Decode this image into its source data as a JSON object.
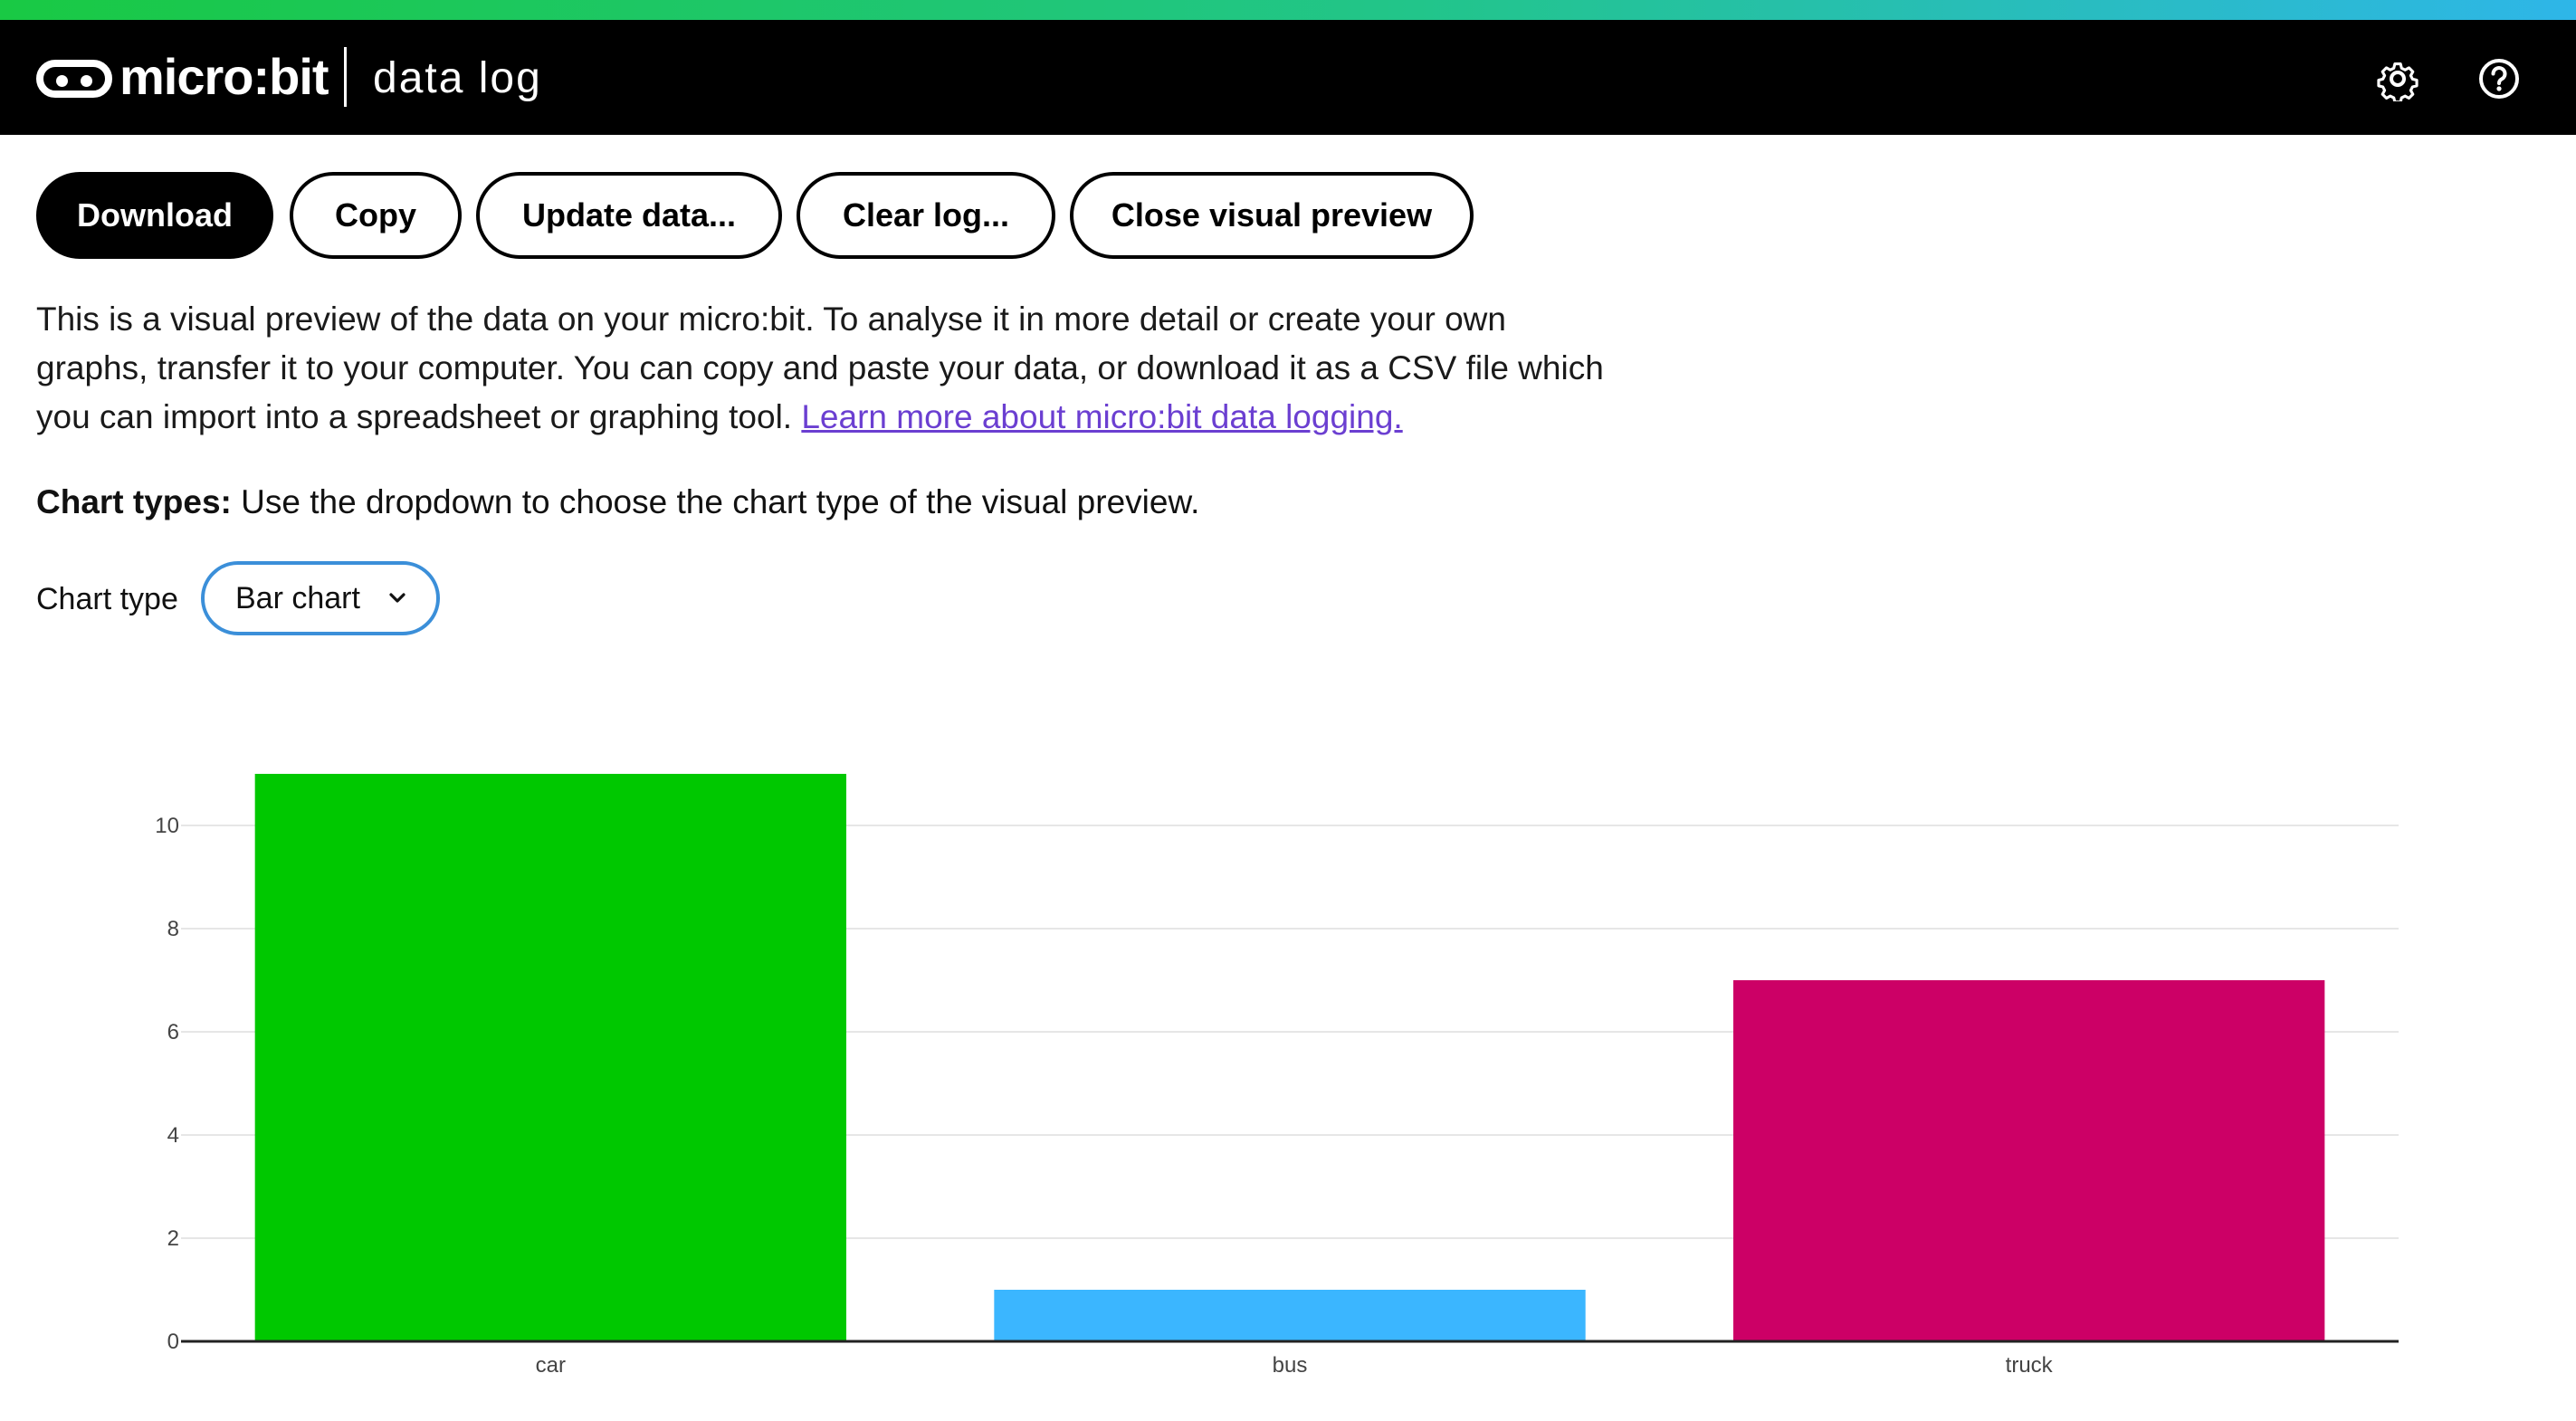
{
  "header": {
    "brand": "micro:bit",
    "app_title": "data log",
    "settings_icon": "gear-icon",
    "help_icon": "help-icon"
  },
  "toolbar": {
    "download": "Download",
    "copy": "Copy",
    "update": "Update data...",
    "clear": "Clear log...",
    "close_preview": "Close visual preview"
  },
  "intro": {
    "text": "This is a visual preview of the data on your micro:bit. To analyse it in more detail or create your own graphs, transfer it to your computer. You can copy and paste your data, or download it as a CSV file which you can import into a spreadsheet or graphing tool.",
    "link": "Learn more about micro:bit data logging."
  },
  "chart_types": {
    "label": "Chart types:",
    "text": "Use the dropdown to choose the chart type of the visual preview."
  },
  "chart_type_select": {
    "label": "Chart type",
    "value": "Bar chart"
  },
  "colors": {
    "accent_start": "#19c944",
    "accent_end": "#2eb6e8",
    "link": "#6b3fd1",
    "select_border": "#3b8fd9"
  },
  "chart_data": {
    "type": "bar",
    "categories": [
      "car",
      "bus",
      "truck"
    ],
    "values": [
      11,
      1,
      7
    ],
    "colors": [
      "#00c800",
      "#3bb6ff",
      "#cc0066"
    ],
    "yticks": [
      0,
      2,
      4,
      6,
      8,
      10
    ],
    "ylim": [
      0,
      11
    ],
    "grid": true
  }
}
